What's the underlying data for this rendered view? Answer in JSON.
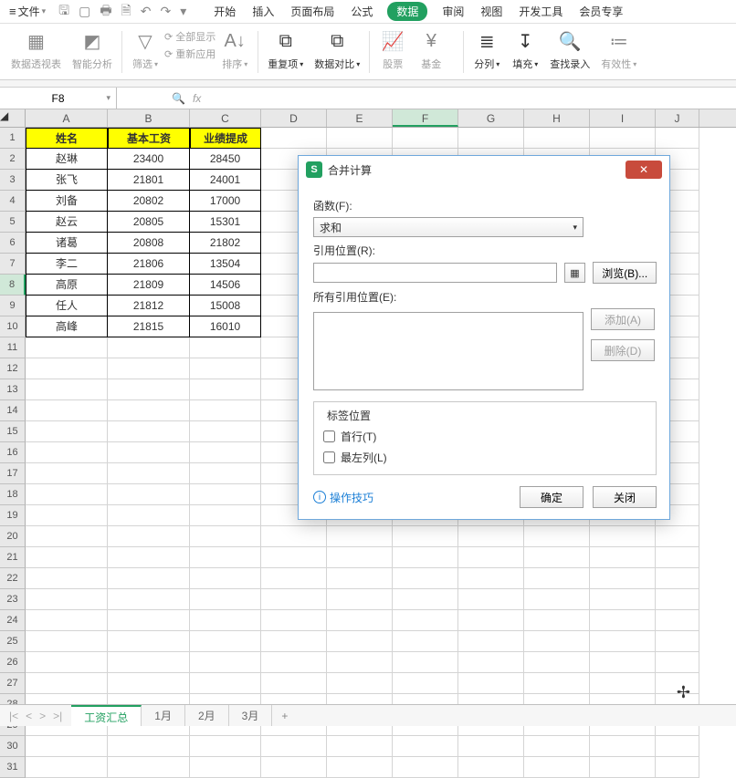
{
  "menu": {
    "file": "文件"
  },
  "tabs": [
    "开始",
    "插入",
    "页面布局",
    "公式",
    "数据",
    "审阅",
    "视图",
    "开发工具",
    "会员专享"
  ],
  "tabs_active_index": 4,
  "ribbon": {
    "g1": "数据透视表",
    "g2": "智能分析",
    "g3": "筛选",
    "g3a": "全部显示",
    "g3b": "重新应用",
    "g4": "排序",
    "g5": "重复项",
    "g6": "数据对比",
    "g7": "股票",
    "g8": "基金",
    "g9": "分列",
    "g10": "填充",
    "g11": "查找录入",
    "g12": "有效性"
  },
  "namebox": "F8",
  "columns": [
    "A",
    "B",
    "C",
    "D",
    "E",
    "F",
    "G",
    "H",
    "I",
    "J"
  ],
  "col_widths": [
    "cA",
    "cB",
    "cC",
    "cD",
    "cE",
    "cF",
    "cG",
    "cH",
    "cI",
    "cJ"
  ],
  "rows_count": 31,
  "selected": {
    "row": 8,
    "col": "F"
  },
  "headers": [
    "姓名",
    "基本工资",
    "业绩提成"
  ],
  "data": [
    [
      "赵琳",
      "23400",
      "28450"
    ],
    [
      "张飞",
      "21801",
      "24001"
    ],
    [
      "刘备",
      "20802",
      "17000"
    ],
    [
      "赵云",
      "20805",
      "15301"
    ],
    [
      "诸葛",
      "20808",
      "21802"
    ],
    [
      "李二",
      "21806",
      "13504"
    ],
    [
      "高原",
      "21809",
      "14506"
    ],
    [
      "任人",
      "21812",
      "15008"
    ],
    [
      "高峰",
      "21815",
      "16010"
    ]
  ],
  "sheets": [
    "工资汇总",
    "1月",
    "2月",
    "3月"
  ],
  "sheet_active_index": 0,
  "dialog": {
    "title": "合并计算",
    "fn_label": "函数(F):",
    "fn_value": "求和",
    "ref_label": "引用位置(R):",
    "browse": "浏览(B)...",
    "all_label": "所有引用位置(E):",
    "add": "添加(A)",
    "del": "删除(D)",
    "pos_label": "标签位置",
    "top_row": "首行(T)",
    "left_col": "最左列(L)",
    "tips": "操作技巧",
    "ok": "确定",
    "close": "关闭"
  }
}
